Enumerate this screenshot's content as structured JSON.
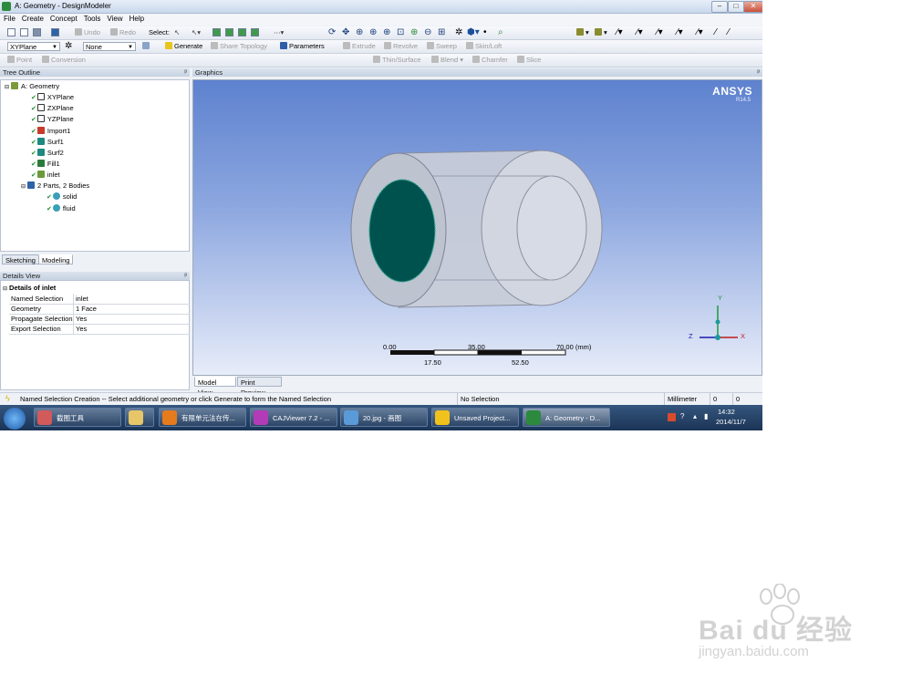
{
  "window": {
    "title": "A: Geometry - DesignModeler",
    "min": "–",
    "max": "□",
    "close": "✕"
  },
  "menu": [
    "File",
    "Create",
    "Concept",
    "Tools",
    "View",
    "Help"
  ],
  "toolbar1": {
    "undo": "Undo",
    "redo": "Redo",
    "select_label": "Select:"
  },
  "toolbar2": {
    "plane": "XYPlane",
    "sketch": "None",
    "generate": "Generate",
    "share_topology": "Share Topology",
    "parameters": "Parameters",
    "extrude": "Extrude",
    "revolve": "Revolve",
    "sweep": "Sweep",
    "skinloft": "Skin/Loft"
  },
  "toolbar3": {
    "point": "Point",
    "conversion": "Conversion",
    "thin": "Thin/Surface",
    "blend": "Blend",
    "chamfer": "Chamfer",
    "slice": "Slice"
  },
  "tree": {
    "header": "Tree Outline",
    "pin": "ᵖ",
    "nodes": [
      {
        "label": "A: Geometry",
        "icon": "geometry-icon"
      },
      {
        "label": "XYPlane",
        "icon": "plane-icon"
      },
      {
        "label": "ZXPlane",
        "icon": "plane-icon"
      },
      {
        "label": "YZPlane",
        "icon": "plane-icon"
      },
      {
        "label": "Import1",
        "icon": "import-icon"
      },
      {
        "label": "Surf1",
        "icon": "surface-icon"
      },
      {
        "label": "Surf2",
        "icon": "surface-icon"
      },
      {
        "label": "Fill1",
        "icon": "fill-icon"
      },
      {
        "label": "inlet",
        "icon": "named-selection-icon"
      },
      {
        "label": "2 Parts, 2 Bodies",
        "icon": "parts-icon"
      },
      {
        "label": "solid",
        "icon": "body-icon"
      },
      {
        "label": "fluid",
        "icon": "body-icon"
      }
    ]
  },
  "tabs": {
    "sketching": "Sketching",
    "modeling": "Modeling"
  },
  "details": {
    "header": "Details View",
    "group": "Details of inlet",
    "rows": [
      {
        "key": "Named Selection",
        "value": "inlet"
      },
      {
        "key": "Geometry",
        "value": "1 Face"
      },
      {
        "key": "Propagate Selection",
        "value": "Yes"
      },
      {
        "key": "Export Selection",
        "value": "Yes"
      }
    ]
  },
  "graphics": {
    "header": "Graphics",
    "brand": "ANSYS",
    "version": "R14.5",
    "scale_top": [
      "0.00",
      "35.00",
      "70.00 (mm)"
    ],
    "scale_bottom": [
      "17.50",
      "52.50"
    ],
    "triad": {
      "x": "X",
      "y": "Y",
      "z": "Z"
    },
    "tabs": {
      "model": "Model View",
      "print": "Print Preview"
    },
    "colors": {
      "face": "#00524f",
      "body": "#c9cdd8"
    }
  },
  "status": {
    "message": "Named Selection Creation -- Select additional geometry or click Generate to form the Named Selection",
    "selection": "No Selection",
    "units": "Millimeter",
    "v1": "0",
    "v2": "0"
  },
  "taskbar": {
    "items": [
      "截图工具",
      "",
      "有限单元法在传...",
      "CAJViewer 7.2 - ...",
      "20.jpg - 画图",
      "Unsaved Project...",
      "A: Geometry - D..."
    ],
    "time": "14:32",
    "date": "2014/11/7"
  },
  "watermark": {
    "brand": "Bai du 经验",
    "url": "jingyan.baidu.com"
  }
}
